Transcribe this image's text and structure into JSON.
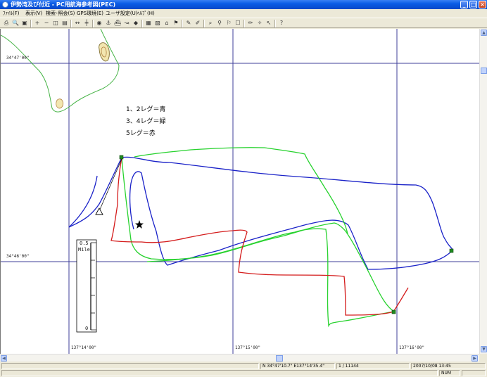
{
  "window": {
    "title": "伊勢湾及び付近 - PC用航海参考図(PEC)",
    "buttons": {
      "minimize": "_",
      "maximize": "□",
      "close": "×"
    }
  },
  "menu": [
    "ﾌｧｲﾙ(F)",
    "表示(V)",
    "検索･照会(S)",
    "GPS環境(E)",
    "ユーザ設定(U)",
    "ﾍﾙﾌﾟ(H)"
  ],
  "toolbar": {
    "icons": [
      "print-icon",
      "print-preview-icon",
      "save-icon",
      "zoom-in-icon",
      "zoom-out-icon",
      "fit-icon",
      "page-icon",
      "measure-icon",
      "ruler-icon",
      "binoculars-icon",
      "anchor-icon",
      "ship-icon",
      "route-icon",
      "mark-icon",
      "grid-icon",
      "map-icon",
      "tag-icon",
      "flag-icon",
      "note-icon",
      "pen-icon",
      "search-mark-icon",
      "pin-icon",
      "flag2-icon",
      "box-icon",
      "pencil-icon",
      "compass-icon",
      "cursor-icon",
      "help-icon"
    ]
  },
  "map": {
    "lat_labels": [
      "34°47'00\"",
      "34°46'00\""
    ],
    "lon_labels": [
      "137°14'00\"",
      "137°15'00\"",
      "137°16'00\""
    ],
    "legend": [
      "1、2レグ＝青",
      "3、4レグ＝緑",
      "5レグ＝赤"
    ],
    "scale": {
      "top_value": "0.5",
      "unit": "Mile",
      "bottom_value": "0"
    },
    "colors": {
      "blue_track": "#1a22c8",
      "green_track": "#27d22e",
      "red_track": "#d41c1c",
      "coast": "#47b447",
      "grid": "#3f3f9a"
    }
  },
  "status": {
    "position": "N 34°47'10.7\" E137°14'35.4\"",
    "scale": "1 / 11144",
    "datetime": "2007/10/08 13:45",
    "num": "NUM"
  }
}
